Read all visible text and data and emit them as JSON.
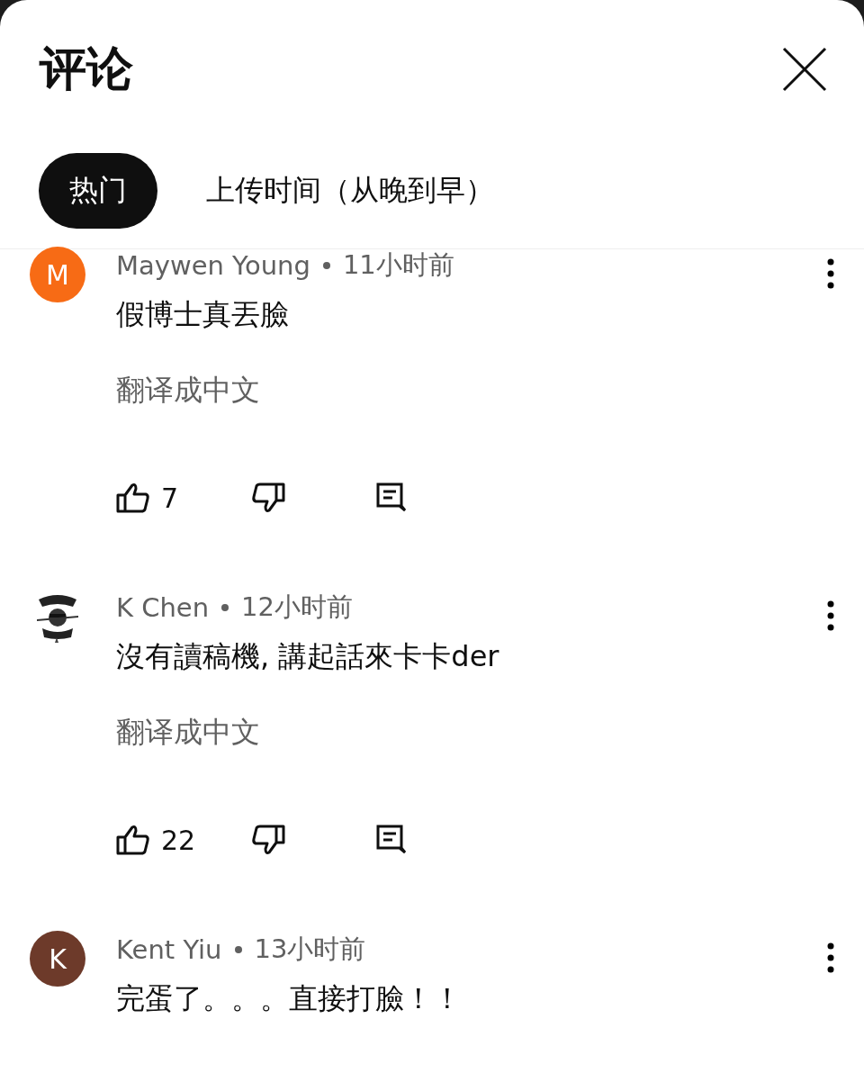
{
  "title": "评论",
  "tabs": [
    {
      "label": "热门",
      "selected": true
    },
    {
      "label": "上传时间（从晚到早）",
      "selected": false
    }
  ],
  "comments": [
    {
      "author": "Maywen Young",
      "time": "11小时前",
      "avatar": {
        "kind": "letter",
        "letter": "M",
        "color": "#f76b15"
      },
      "text": "假博士真丟臉",
      "translate": "翻译成中文",
      "likes": "7"
    },
    {
      "author": "K Chen",
      "time": "12小时前",
      "text": "沒有讀稿機, 講起話來卡卡der",
      "translate": "翻译成中文",
      "likes": "22"
    },
    {
      "author": "Kent Yiu",
      "time": "13小时前",
      "avatar": {
        "kind": "letter",
        "letter": "K",
        "color": "#6d3a2a"
      },
      "text": "完蛋了。。。直接打臉！！"
    }
  ]
}
